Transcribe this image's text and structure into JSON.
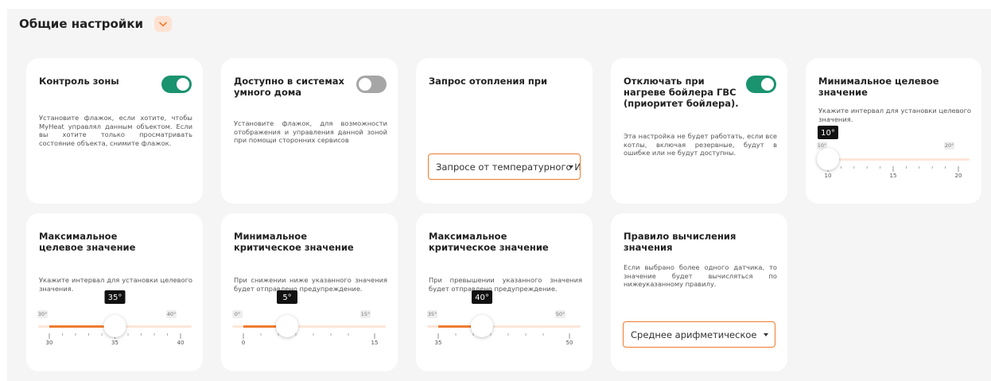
{
  "section": {
    "title": "Общие настройки"
  },
  "cards": {
    "zone_control": {
      "title": "Контроль зоны",
      "description": "Установите флажок, если хотите, чтобы MyHeat управлял данным объектом. Если вы хотите только просматривать состояние объекта, снимите флажок.",
      "enabled": true
    },
    "smart_home": {
      "title": "Доступно в системах умного дома",
      "description": "Установите флажок, для возможности отображения и управления данной зоной при помощи сторонних сервисов",
      "enabled": false
    },
    "heating_request": {
      "title": "Запрос отопления при",
      "selected": "Запросе от температурного И/"
    },
    "boiler_priority": {
      "title": "Отключать при нагреве бойлера ГВС (приоритет бойлера).",
      "description": "Эта настройка не будет работать, если все котлы, включая резервные, будут в ошибке или не будут доступны.",
      "enabled": true
    },
    "min_target": {
      "title": "Минимальное целевое значение",
      "description": "Укажите интервал для установки целевого значения.",
      "value": 10,
      "min": 10,
      "max": 20,
      "value_label": "10°",
      "min_label": "10°",
      "max_label": "20°",
      "ticks": [
        {
          "v": 10,
          "label": "10"
        },
        {
          "v": 15,
          "label": "15"
        },
        {
          "v": 20,
          "label": "20"
        }
      ],
      "minor": [
        11,
        12,
        13,
        14,
        16,
        17,
        18,
        19
      ]
    },
    "max_target": {
      "title": "Максимальное целевое значение",
      "description": "Укажите интервал для установки целевого значения.",
      "value": 35,
      "min": 30,
      "max": 40,
      "value_label": "35°",
      "min_label": "30°",
      "max_label": "40°",
      "ticks": [
        {
          "v": 30,
          "label": "30"
        },
        {
          "v": 35,
          "label": "35"
        },
        {
          "v": 40,
          "label": "40"
        }
      ],
      "minor": [
        31,
        32,
        33,
        34,
        36,
        37,
        38,
        39
      ]
    },
    "min_critical": {
      "title": "Минимальное критическое значение",
      "description": "При снижении ниже указанного значения будет отправлено предупреждение.",
      "value": 5,
      "min": 0,
      "max": 15,
      "value_label": "5°",
      "min_label": "0°",
      "max_label": "15°",
      "ticks": [
        {
          "v": 0,
          "label": "0"
        },
        {
          "v": 15,
          "label": "15"
        }
      ],
      "minor": [
        2,
        4,
        6,
        8,
        10,
        12
      ]
    },
    "max_critical": {
      "title": "Максимальное критическое значение",
      "description": "При превышении указанного значения будет отправлено предупреждение.",
      "value": 40,
      "min": 35,
      "max": 50,
      "value_label": "40°",
      "min_label": "35°",
      "max_label": "50°",
      "ticks": [
        {
          "v": 35,
          "label": "35"
        },
        {
          "v": 50,
          "label": "50"
        }
      ],
      "minor": [
        37,
        39,
        41,
        43,
        45,
        47
      ]
    },
    "calc_rule": {
      "title": "Правило вычисления значения",
      "description": "Если выбрано более одного датчика, то значение будет вычисляться по нижеуказанному правилу.",
      "selected": "Среднее арифметическое"
    }
  },
  "colors": {
    "accent": "#f07c2e",
    "toggle_on": "#1a936f",
    "toggle_off": "#a6a6a6",
    "track": "#fde6d8"
  }
}
